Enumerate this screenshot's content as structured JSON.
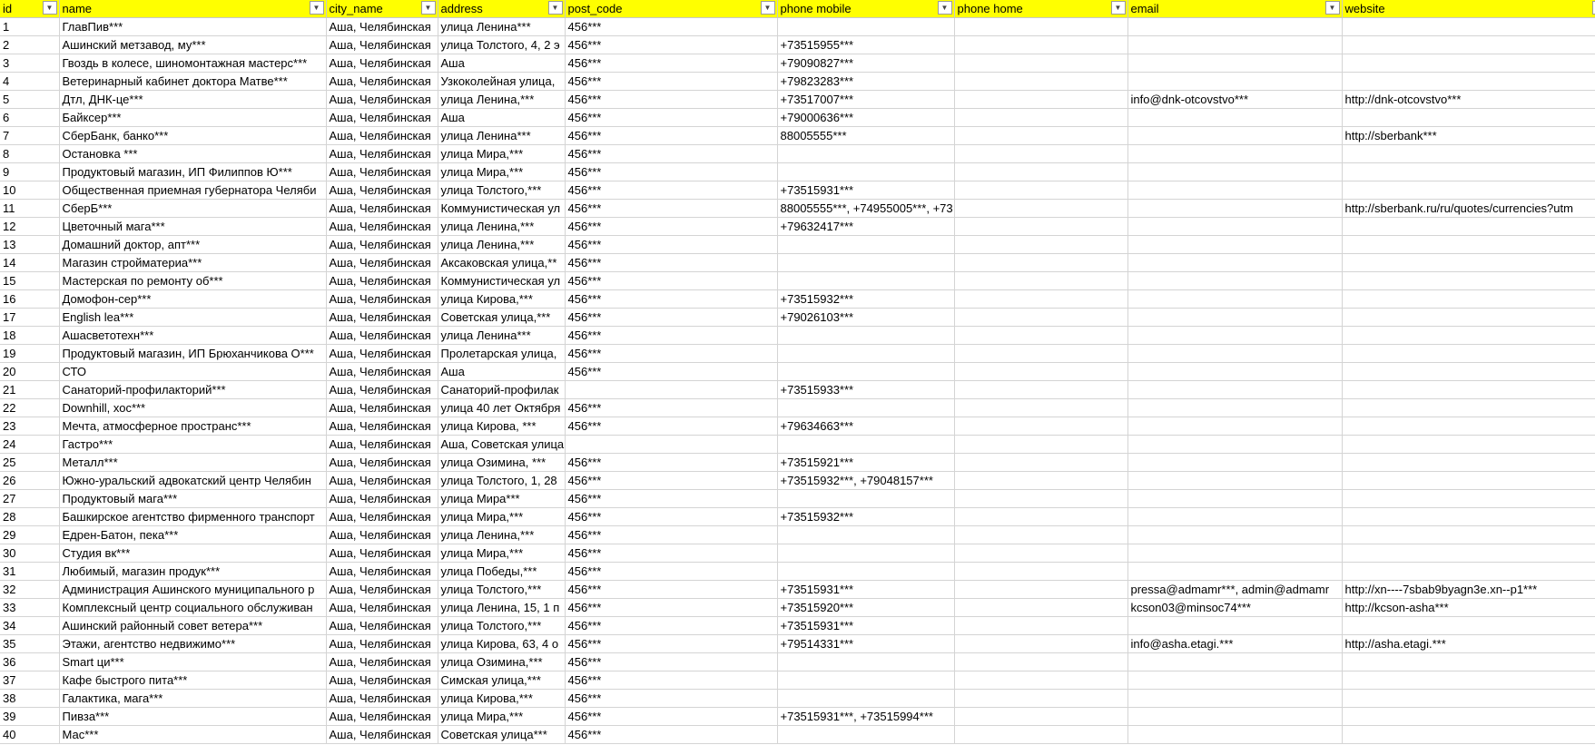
{
  "headers": [
    "id",
    "name",
    "city_name",
    "address",
    "post_code",
    "phone mobile",
    "phone home",
    "email",
    "website"
  ],
  "filter_icon": "chevron-down-icon",
  "rows": [
    [
      "1",
      "ГлавПив***",
      "Аша, Челябинская",
      "улица Ленина***",
      "456***",
      "",
      "",
      "",
      ""
    ],
    [
      "2",
      "Ашинский метзавод, му***",
      "Аша, Челябинская",
      "улица Толстого, 4, 2 э",
      "456***",
      "+73515955***",
      "",
      "",
      ""
    ],
    [
      "3",
      "Гвоздь в колесе, шиномонтажная мастерс***",
      "Аша, Челябинская",
      "Аша",
      "456***",
      "+79090827***",
      "",
      "",
      ""
    ],
    [
      "4",
      "Ветеринарный кабинет доктора Матве***",
      "Аша, Челябинская",
      "Узкоколейная улица,",
      "456***",
      "+79823283***",
      "",
      "",
      ""
    ],
    [
      "5",
      "Дтл, ДНК-це***",
      "Аша, Челябинская",
      "улица Ленина,***",
      "456***",
      "+73517007***",
      "",
      "info@dnk-otcovstvo***",
      "http://dnk-otcovstvo***"
    ],
    [
      "6",
      "Байксер***",
      "Аша, Челябинская",
      "Аша",
      "456***",
      "+79000636***",
      "",
      "",
      ""
    ],
    [
      "7",
      "СберБанк, банко***",
      "Аша, Челябинская",
      "улица Ленина***",
      "456***",
      "88005555***",
      "",
      "",
      "http://sberbank***"
    ],
    [
      "8",
      "Остановка ***",
      "Аша, Челябинская",
      "улица Мира,***",
      "456***",
      "",
      "",
      "",
      ""
    ],
    [
      "9",
      "Продуктовый магазин, ИП Филиппов Ю***",
      "Аша, Челябинская",
      "улица Мира,***",
      "456***",
      "",
      "",
      "",
      ""
    ],
    [
      "10",
      "Общественная приемная губернатора Челяби",
      "Аша, Челябинская",
      "улица Толстого,***",
      "456***",
      "+73515931***",
      "",
      "",
      ""
    ],
    [
      "11",
      "СберБ***",
      "Аша, Челябинская",
      "Коммунистическая ул",
      "456***",
      "88005555***, +74955005***, +73",
      "",
      "",
      "http://sberbank.ru/ru/quotes/currencies?utm"
    ],
    [
      "12",
      "Цветочный мага***",
      "Аша, Челябинская",
      "улица Ленина,***",
      "456***",
      "+79632417***",
      "",
      "",
      ""
    ],
    [
      "13",
      "Домашний доктор, апт***",
      "Аша, Челябинская",
      "улица Ленина,***",
      "456***",
      "",
      "",
      "",
      ""
    ],
    [
      "14",
      "Магазин стройматериа***",
      "Аша, Челябинская",
      "Аксаковская улица,**",
      "456***",
      "",
      "",
      "",
      ""
    ],
    [
      "15",
      "Мастерская по ремонту об***",
      "Аша, Челябинская",
      "Коммунистическая ул",
      "456***",
      "",
      "",
      "",
      ""
    ],
    [
      "16",
      "Домофон-сер***",
      "Аша, Челябинская",
      "улица Кирова,***",
      "456***",
      "+73515932***",
      "",
      "",
      ""
    ],
    [
      "17",
      "English lea***",
      "Аша, Челябинская",
      "Советская улица,***",
      "456***",
      "+79026103***",
      "",
      "",
      ""
    ],
    [
      "18",
      "Ашасветотехн***",
      "Аша, Челябинская",
      "улица Ленина***",
      "456***",
      "",
      "",
      "",
      ""
    ],
    [
      "19",
      "Продуктовый магазин, ИП Брюханчикова О***",
      "Аша, Челябинская",
      "Пролетарская улица,",
      "456***",
      "",
      "",
      "",
      ""
    ],
    [
      "20",
      "СТО",
      "Аша, Челябинская",
      "Аша",
      "456***",
      "",
      "",
      "",
      ""
    ],
    [
      "21",
      "Санаторий-профилакторий***",
      "Аша, Челябинская",
      "Санаторий-профилак",
      "",
      "+73515933***",
      "",
      "",
      ""
    ],
    [
      "22",
      "Downhill, хос***",
      "Аша, Челябинская",
      "улица 40 лет Октября",
      "456***",
      "",
      "",
      "",
      ""
    ],
    [
      "23",
      "Мечта, атмосферное пространс***",
      "Аша, Челябинская",
      "улица Кирова, ***",
      "456***",
      "+79634663***",
      "",
      "",
      ""
    ],
    [
      "24",
      "Гастро***",
      "Аша, Челябинская",
      "Аша, Советская улица",
      "",
      "",
      "",
      "",
      ""
    ],
    [
      "25",
      "Металл***",
      "Аша, Челябинская",
      "улица Озимина, ***",
      "456***",
      "+73515921***",
      "",
      "",
      ""
    ],
    [
      "26",
      "Южно-уральский адвокатский центр Челябин",
      "Аша, Челябинская",
      "улица Толстого, 1, 28",
      "456***",
      "+73515932***, +79048157***",
      "",
      "",
      ""
    ],
    [
      "27",
      "Продуктовый мага***",
      "Аша, Челябинская",
      "улица Мира***",
      "456***",
      "",
      "",
      "",
      ""
    ],
    [
      "28",
      "Башкирское агентство фирменного транспорт",
      "Аша, Челябинская",
      "улица Мира,***",
      "456***",
      "+73515932***",
      "",
      "",
      ""
    ],
    [
      "29",
      "Едрен-Батон, пека***",
      "Аша, Челябинская",
      "улица Ленина,***",
      "456***",
      "",
      "",
      "",
      ""
    ],
    [
      "30",
      "Студия вк***",
      "Аша, Челябинская",
      "улица Мира,***",
      "456***",
      "",
      "",
      "",
      ""
    ],
    [
      "31",
      "Любимый, магазин продук***",
      "Аша, Челябинская",
      "улица Победы,***",
      "456***",
      "",
      "",
      "",
      ""
    ],
    [
      "32",
      "Администрация Ашинского муниципального р",
      "Аша, Челябинская",
      "улица Толстого,***",
      "456***",
      "+73515931***",
      "",
      "pressa@admamr***, admin@admamr",
      "http://xn----7sbab9byagn3e.xn--p1***"
    ],
    [
      "33",
      "Комплексный центр социального обслуживан",
      "Аша, Челябинская",
      "улица Ленина, 15, 1 п",
      "456***",
      "+73515920***",
      "",
      "kcson03@minsoc74***",
      "http://kcson-asha***"
    ],
    [
      "34",
      "Ашинский районный совет ветера***",
      "Аша, Челябинская",
      "улица Толстого,***",
      "456***",
      "+73515931***",
      "",
      "",
      ""
    ],
    [
      "35",
      "Этажи, агентство недвижимо***",
      "Аша, Челябинская",
      "улица Кирова, 63, 4 о",
      "456***",
      "+79514331***",
      "",
      "info@asha.etagi.***",
      "http://asha.etagi.***"
    ],
    [
      "36",
      "Smart ци***",
      "Аша, Челябинская",
      "улица Озимина,***",
      "456***",
      "",
      "",
      "",
      ""
    ],
    [
      "37",
      "Кафе быстрого пита***",
      "Аша, Челябинская",
      "Симская улица,***",
      "456***",
      "",
      "",
      "",
      ""
    ],
    [
      "38",
      "Галактика, мага***",
      "Аша, Челябинская",
      "улица Кирова,***",
      "456***",
      "",
      "",
      "",
      ""
    ],
    [
      "39",
      "Пивза***",
      "Аша, Челябинская",
      "улица Мира,***",
      "456***",
      "+73515931***, +73515994***",
      "",
      "",
      ""
    ],
    [
      "40",
      "Мас***",
      "Аша, Челябинская",
      "Советская улица***",
      "456***",
      "",
      "",
      "",
      ""
    ]
  ]
}
